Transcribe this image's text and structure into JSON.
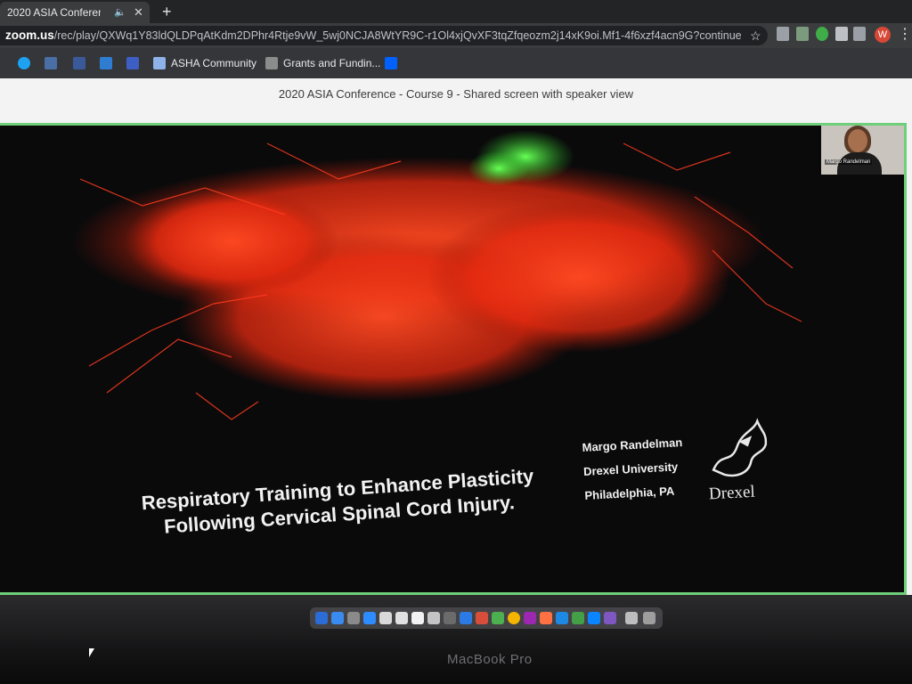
{
  "browser": {
    "tab_title": "2020 ASIA Conference - Co",
    "tab_speaker_icon": "speaker-icon",
    "tab_close": "✕",
    "new_tab": "+",
    "url_host": "zoom.us",
    "url_path": "/rec/play/QXWq1Y83ldQLDPqAtKdm2DPhr4Rtje9vW_5wj0NCJA8WtYR9C-r1Ol4xjQvXF3tqZfqeozm2j14xK9oi.Mf1-4f6xzf4acn9G?continue...",
    "avatar_letter": "W",
    "bookmarks": [
      "ASHA Community",
      "Grants and Fundin..."
    ]
  },
  "page": {
    "recording_title": "2020 ASIA Conference - Course 9 - Shared screen with speaker view",
    "slide": {
      "title_line1": "Respiratory Training to Enhance Plasticity",
      "title_line2": "Following Cervical Spinal Cord Injury.",
      "presenter": "Margo Randelman",
      "university": "Drexel University",
      "location": "Philadelphia, PA",
      "logo_text": "Drexel"
    },
    "speaker_thumbnail_name": "Margo Randelman"
  },
  "device": {
    "label": "MacBook Pro"
  },
  "colors": {
    "active_speaker_border": "#6fcf7a",
    "neuron_red": "#ff3b1f",
    "neuron_green": "#4dff4a"
  }
}
